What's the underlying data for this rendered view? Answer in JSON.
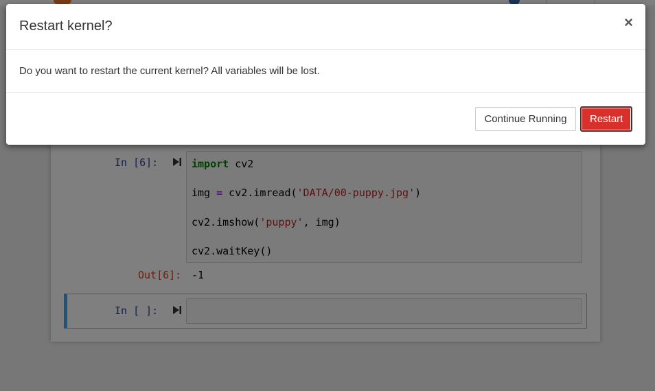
{
  "modal": {
    "title": "Restart kernel?",
    "close_glyph": "×",
    "message": "Do you want to restart the current kernel? All variables will be lost.",
    "continue_label": "Continue Running",
    "restart_label": "Restart"
  },
  "notebook": {
    "cells": [
      {
        "in_prompt": "In [6]:",
        "code": [
          {
            "tokens": [
              {
                "t": "import",
                "k": "kw"
              },
              {
                "t": " cv2",
                "k": ""
              }
            ]
          },
          {
            "tokens": [
              {
                "t": "img ",
                "k": ""
              },
              {
                "t": "=",
                "k": "op"
              },
              {
                "t": " cv2.imread(",
                "k": ""
              },
              {
                "t": "'DATA/00-puppy.jpg'",
                "k": "str"
              },
              {
                "t": ")",
                "k": ""
              }
            ]
          },
          {
            "tokens": [
              {
                "t": "cv2.imshow(",
                "k": ""
              },
              {
                "t": "'puppy'",
                "k": "str"
              },
              {
                "t": ", img)",
                "k": ""
              }
            ]
          },
          {
            "tokens": [
              {
                "t": "cv2.waitKey()",
                "k": ""
              }
            ]
          }
        ],
        "out_prompt": "Out[6]:",
        "output": "-1"
      },
      {
        "in_prompt": "In [ ]:",
        "code": []
      }
    ]
  },
  "colors": {
    "restart_button": "#d9302c",
    "selected_cell_bar": "#42a5f5",
    "in_prompt": "#303f9f",
    "out_prompt": "#d84315"
  },
  "icons": {
    "run_cell": "step-forward-icon",
    "close": "close-icon"
  }
}
